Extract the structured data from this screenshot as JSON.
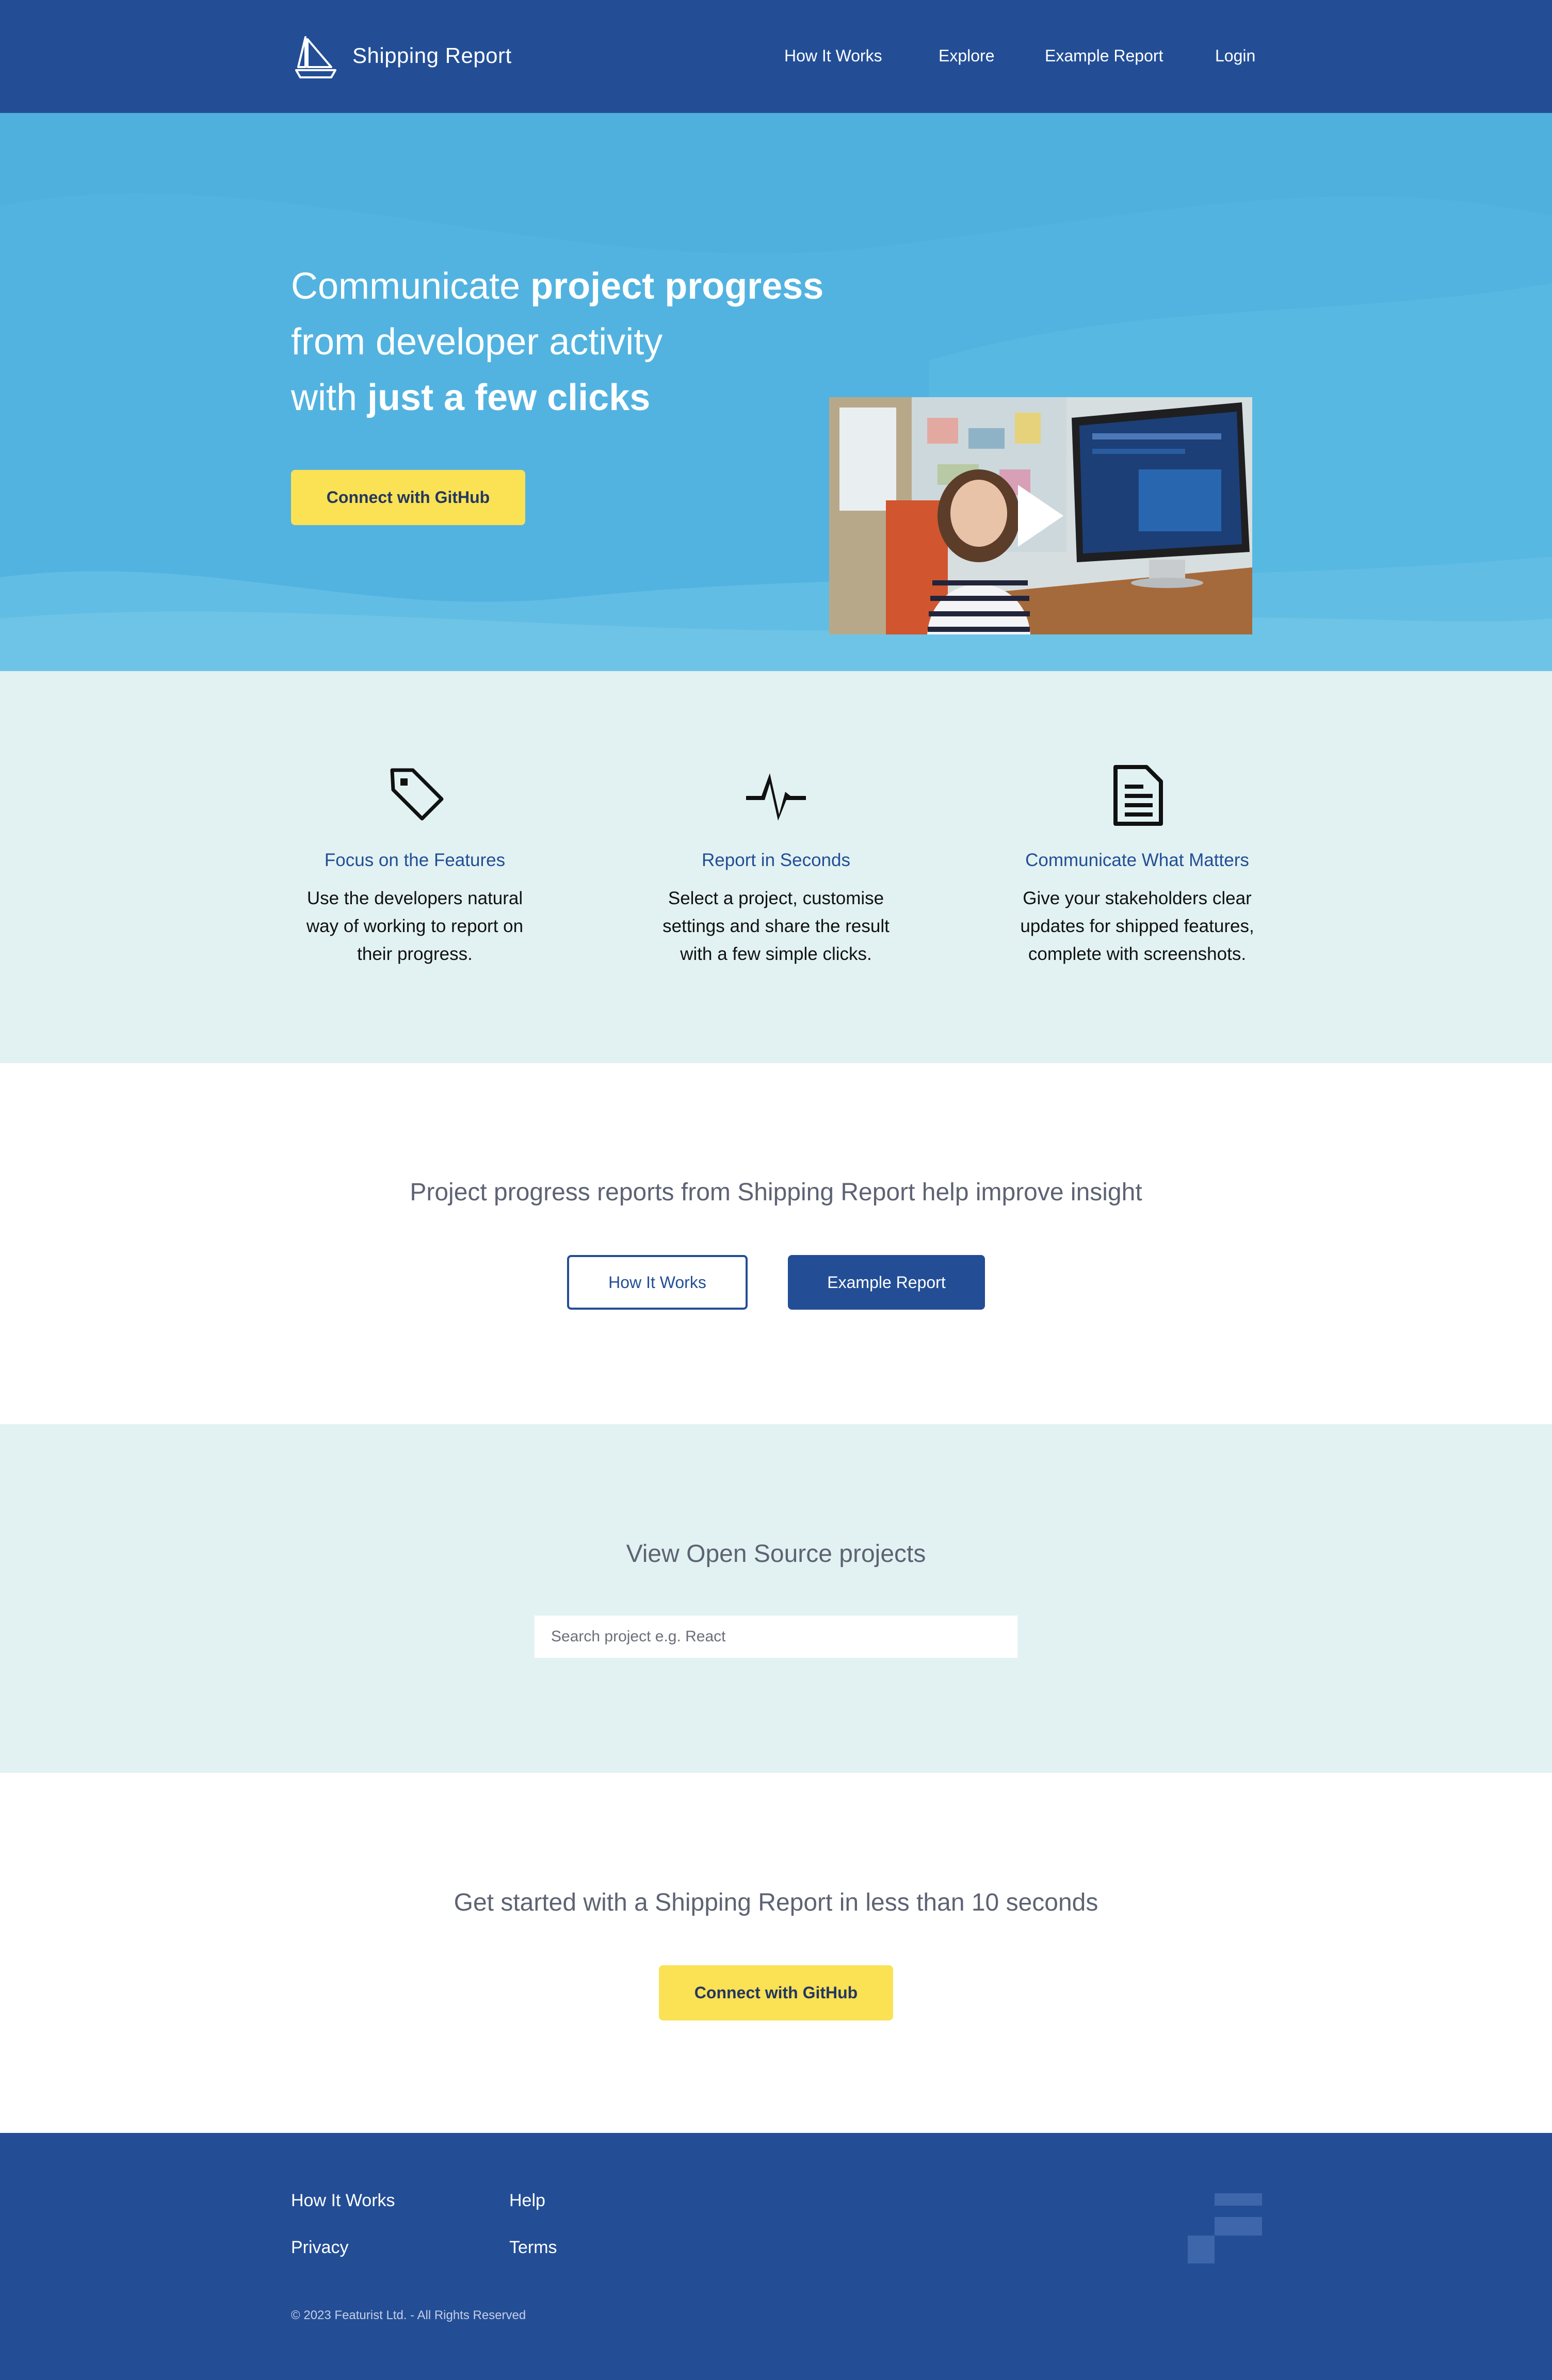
{
  "nav": {
    "brand": "Shipping Report",
    "links": [
      "How It Works",
      "Explore",
      "Example Report",
      "Login"
    ]
  },
  "hero": {
    "line1_regular": "Communicate ",
    "line1_bold": "project progress",
    "line2_regular": "from developer activity",
    "line3_regular": "with ",
    "line3_bold": "just a few clicks",
    "cta": "Connect with GitHub",
    "video_icon": "play-icon"
  },
  "features": [
    {
      "icon": "tag-icon",
      "title": "Focus on the Features",
      "lines": [
        "Use the developers natural",
        "way of working to report on",
        "their progress."
      ]
    },
    {
      "icon": "activity-pulse-icon",
      "title": "Report in Seconds",
      "lines": [
        "Select a project, customise",
        "settings and share the result",
        "with a few simple clicks."
      ]
    },
    {
      "icon": "document-icon",
      "title": "Communicate What Matters",
      "lines": [
        "Give your stakeholders clear",
        "updates for shipped features,",
        "complete with screenshots."
      ]
    }
  ],
  "insight": {
    "heading": "Project progress reports from Shipping Report help improve insight",
    "how_it_works": "How It Works",
    "example_report": "Example Report"
  },
  "opensource": {
    "heading": "View Open Source projects",
    "search_placeholder": "Search project e.g. React"
  },
  "getstarted": {
    "heading": "Get started with a Shipping Report in less than 10 seconds",
    "cta": "Connect with GitHub"
  },
  "footer": {
    "links": [
      "How It Works",
      "Help",
      "Privacy",
      "Terms"
    ],
    "copyright": "© 2023 Featurist Ltd. - All Rights Reserved",
    "logo_icon": "featurist-logo-icon"
  },
  "colors": {
    "nav_blue": "#234e96",
    "hero_blue": "#52b3e0",
    "pale_teal": "#e2f2f2",
    "cta_yellow": "#fbe154"
  }
}
